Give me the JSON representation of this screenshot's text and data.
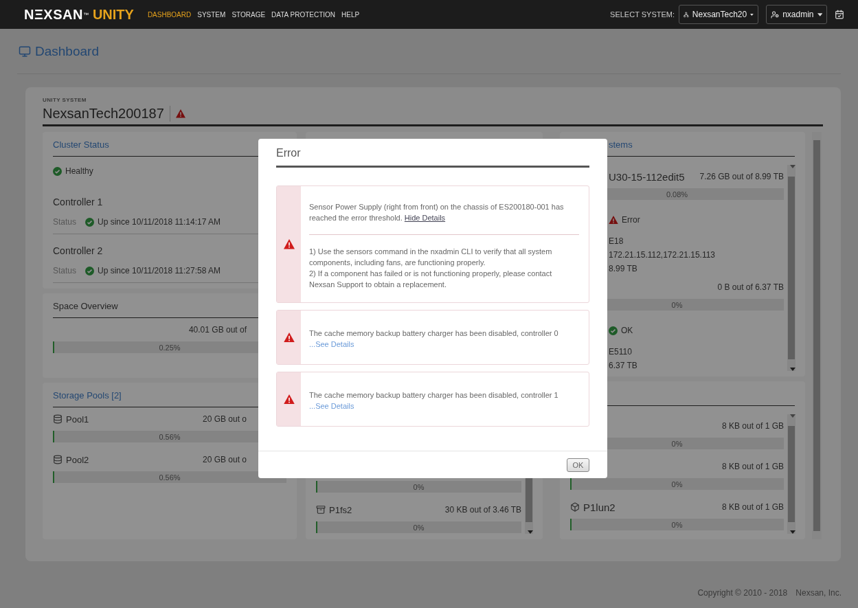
{
  "topbar": {
    "brand": "NΞXSAN",
    "brand_mark": "™",
    "product": "UNITY",
    "nav": [
      {
        "label": "DASHBOARD",
        "selected": true
      },
      {
        "label": "SYSTEM",
        "selected": false
      },
      {
        "label": "STORAGE",
        "selected": false
      },
      {
        "label": "DATA PROTECTION",
        "selected": false
      },
      {
        "label": "HELP",
        "selected": false
      }
    ],
    "system_label": "SELECT SYSTEM:",
    "system_value": "NexsanTech20",
    "user": "nxadmin"
  },
  "page_title": "Dashboard",
  "system": {
    "label": "UNITY SYSTEM",
    "name": "NexsanTech200187",
    "ok": false
  },
  "columns": [
    [
      {
        "title": "Cluster Status",
        "link": true,
        "rows": [
          {
            "kind": "status",
            "ok": true,
            "text": "Healthy"
          },
          {
            "kind": "heading",
            "text": "Controller 1"
          },
          {
            "kind": "field",
            "label": "Status",
            "ok": true,
            "text": "Up since 10/11/2018 11:14:17 AM"
          },
          {
            "kind": "heading",
            "text": "Controller 2"
          },
          {
            "kind": "field",
            "label": "Status",
            "ok": true,
            "text": "Up since 10/11/2018 11:27:58 AM"
          }
        ]
      },
      {
        "title": "Space Overview",
        "link": false,
        "rows": [
          {
            "kind": "usage",
            "usage": "40.01 GB out of"
          },
          {
            "kind": "bar",
            "level": 0.0025,
            "percent": "0.25%"
          }
        ]
      },
      {
        "title": "Storage Pools [2]",
        "link": true,
        "rows": [
          {
            "kind": "item",
            "name": "Pool1",
            "usage": "20 GB out o"
          },
          {
            "kind": "bar",
            "level": 0.0056,
            "percent": "0.56%"
          },
          {
            "kind": "item",
            "name": "Pool2",
            "usage": "20 GB out o"
          },
          {
            "kind": "bar",
            "level": 0.0056,
            "percent": "0.56%"
          }
        ]
      }
    ],
    [
      {},
      {
        "scrollable": true,
        "rows": [
          {
            "kind": "bar",
            "level": 0,
            "percent": "0%"
          },
          {
            "kind": "item",
            "name": "P1fs2",
            "usage": "30 KB out of 3.46 TB"
          },
          {
            "kind": "bar",
            "level": 0,
            "percent": "0%"
          }
        ]
      }
    ],
    [
      {
        "title": "stems",
        "link": true,
        "scrollable": true,
        "rows": [
          {
            "kind": "usage",
            "name": "U30-15-112edit5",
            "usage": "7.26 GB out of 8.99 TB"
          },
          {
            "kind": "bar",
            "level": 0.0008,
            "percent": "0.08%"
          },
          {
            "kind": "status",
            "ok": false,
            "text": "Error"
          },
          {
            "kind": "line",
            "text": "E18"
          },
          {
            "kind": "line",
            "text": "172.21.15.112,172.21.15.113"
          },
          {
            "kind": "line",
            "text": "8.99 TB"
          },
          {
            "kind": "usage",
            "usage": "0 B out of 6.37 TB"
          },
          {
            "kind": "bar",
            "level": 0,
            "percent": "0%"
          },
          {
            "kind": "status",
            "ok": true,
            "text": "OK"
          },
          {
            "kind": "line",
            "text": "E5110"
          },
          {
            "kind": "line",
            "text": "6.37 TB"
          }
        ]
      },
      {
        "scrollable": true,
        "rows": [
          {
            "kind": "usage",
            "usage": "8 KB out of 1 GB"
          },
          {
            "kind": "bar",
            "level": 0,
            "percent": "0%"
          },
          {
            "kind": "usage",
            "usage": "8 KB out of 1 GB"
          },
          {
            "kind": "bar",
            "level": 0,
            "percent": "0%"
          },
          {
            "kind": "item",
            "name": "P1lun2",
            "usage": "8 KB out of 1 GB"
          },
          {
            "kind": "bar",
            "level": 0,
            "percent": "0%"
          }
        ]
      }
    ]
  ],
  "dialog": {
    "title": "Error",
    "alerts": [
      {
        "text": "Sensor Power Supply (right from front) on the chassis of ES200180-001 has reached the error threshold.",
        "link": "Hide Details",
        "expanded": true,
        "details": [
          "1) Use the sensors command in the nxadmin CLI to verify that all system components, including fans, are functioning properly.",
          "2) If a component has failed or is not functioning properly, please contact Nexsan Support to obtain a replacement."
        ]
      },
      {
        "text": "The cache memory backup battery charger has been disabled, controller 0",
        "link": "...See Details",
        "expanded": false
      },
      {
        "text": "The cache memory backup battery charger has been disabled, controller 1",
        "link": "...See Details",
        "expanded": false
      }
    ],
    "button": "OK"
  },
  "footer": {
    "copyright": "Copyright © 2010 - 2018",
    "company": "Nexsan, Inc."
  }
}
